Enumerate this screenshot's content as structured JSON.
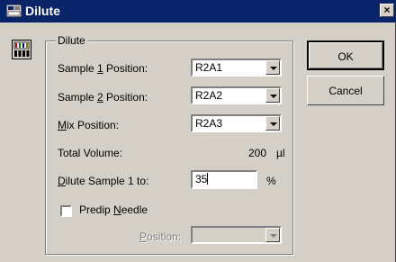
{
  "window": {
    "title": "Dilute",
    "close_glyph": "×"
  },
  "groupbox": {
    "label": "Dilute"
  },
  "fields": {
    "sample1": {
      "label_pre": "Sample ",
      "label_ul": "1",
      "label_post": " Position:",
      "value": "R2A1"
    },
    "sample2": {
      "label_pre": "Sample ",
      "label_ul": "2",
      "label_post": " Position:",
      "value": "R2A2"
    },
    "mix": {
      "label_pre": "",
      "label_ul": "M",
      "label_post": "ix Position:",
      "value": "R2A3"
    },
    "total_volume": {
      "label": "Total Volume:",
      "value": "200",
      "unit": "µl"
    },
    "dilute": {
      "label_pre": "",
      "label_ul": "D",
      "label_post": "ilute Sample 1 to:",
      "value": "35",
      "unit": "%"
    }
  },
  "predip": {
    "label_pre": "Predip ",
    "label_ul": "N",
    "label_post": "eedle",
    "checked": false
  },
  "position": {
    "label_pre": "",
    "label_ul": "P",
    "label_post": "osition:",
    "value": ""
  },
  "buttons": {
    "ok": "OK",
    "cancel": "Cancel"
  },
  "icons": {
    "title": "dilute-window-icon",
    "app": "instrument-icon",
    "dropdown": "chevron-down-icon"
  },
  "colors": {
    "titlebar": "#0a246a",
    "face": "#d4d0c8"
  }
}
